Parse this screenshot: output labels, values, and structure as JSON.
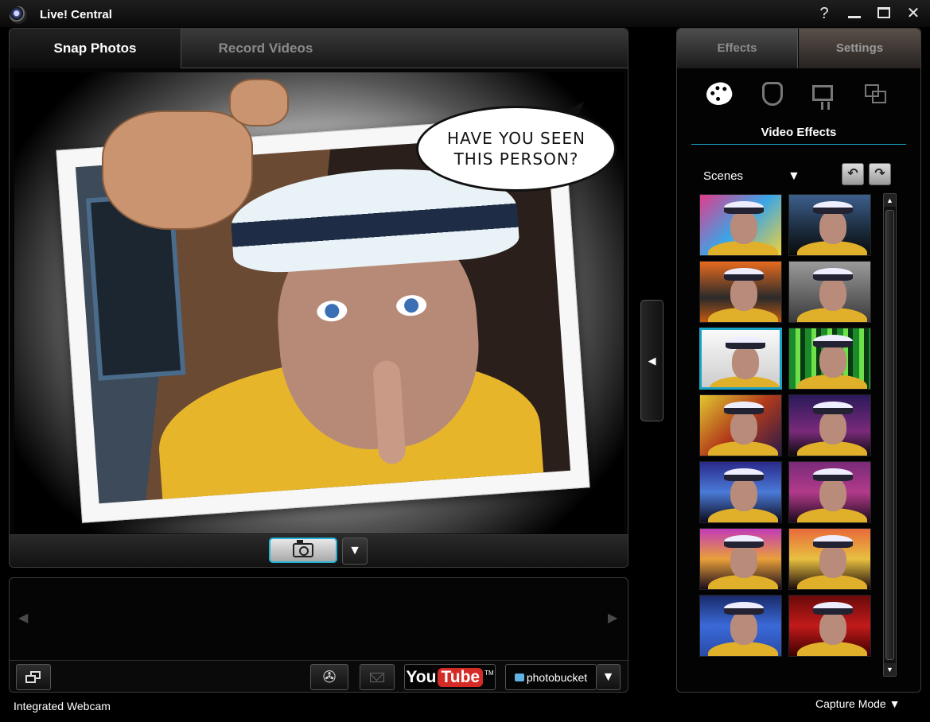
{
  "window": {
    "title": "Live! Central",
    "help": "?"
  },
  "main": {
    "tabs": [
      {
        "label": "Snap Photos",
        "active": true
      },
      {
        "label": "Record Videos",
        "active": false
      }
    ],
    "preview": {
      "speech_bubble": [
        "HAVE YOU SEEN",
        "THIS PERSON?"
      ]
    },
    "capture_dropdown": "▼"
  },
  "gallery": {
    "prev": "◀",
    "next": "▶",
    "toolbar": {
      "youtube_you": "You",
      "youtube_tube": "Tube",
      "youtube_tm": "TM",
      "photobucket": "photobucket",
      "photobucket_dropdown": "▼"
    }
  },
  "status": {
    "device": "Integrated Webcam",
    "capture_mode": "Capture Mode ▼"
  },
  "collapse": "◀",
  "right": {
    "tabs": [
      {
        "label": "Effects",
        "active": true
      },
      {
        "label": "Settings",
        "active": false
      }
    ],
    "effect_categories": [
      "palette-icon",
      "mask-icon",
      "easel-icon",
      "frames-icon"
    ],
    "section_title": "Video Effects",
    "scenes": {
      "label": "Scenes",
      "dropdown": "▼",
      "undo": "↶",
      "redo": "↷"
    },
    "thumbnails": [
      {
        "bg": "linear-gradient(135deg,#e23c8a,#3aa5e8 50%,#f0d23a)"
      },
      {
        "bg": "linear-gradient(#3c5f8c,#1a2a3a 60%,#0a0a0a)"
      },
      {
        "bg": "linear-gradient(#e86b1f,#2a2a2a 60%,#c55a10)"
      },
      {
        "bg": "linear-gradient(#9a9a9a,#3a3a3a)"
      },
      {
        "bg": "linear-gradient(#fafafa,#ccc)",
        "selected": true
      },
      {
        "bg": "repeating-linear-gradient(90deg,#1a8a2a 0 8px,#6ee04a 8px 14px,#0a3a12 14px 20px)"
      },
      {
        "bg": "linear-gradient(135deg,#e0c830,#b23a1a 50%,#2a1a4a)"
      },
      {
        "bg": "linear-gradient(#2a1a5a,#7a2a7a 60%,#0a0a0a)"
      },
      {
        "bg": "linear-gradient(#2a2a8a,#4a7ad8 50%,#0a0a1a)"
      },
      {
        "bg": "linear-gradient(#7a2a7a,#b23a8a 50%,#1a0a1a)"
      },
      {
        "bg": "linear-gradient(#c23ab8,#e8a03a 50%,#1a0a1a)"
      },
      {
        "bg": "linear-gradient(#e86a3a,#e8c040 50%,#1a0a0a)"
      },
      {
        "bg": "linear-gradient(#1a2a6a,#3a6ad8 50%,#2a4aa8)"
      },
      {
        "bg": "linear-gradient(#6a0a0a,#c21a1a 50%,#3a0000)"
      }
    ],
    "scroll_up": "▲",
    "scroll_down": "▼"
  }
}
